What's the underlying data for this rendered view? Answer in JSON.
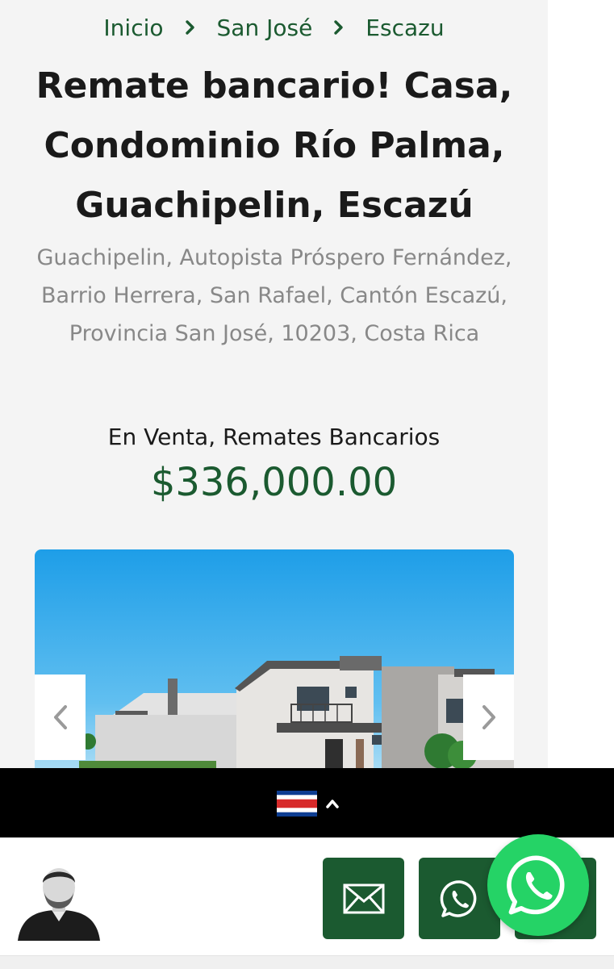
{
  "breadcrumb": {
    "items": [
      "Inicio",
      "San José",
      "Escazu"
    ],
    "separator_icon": "chevron-right-icon"
  },
  "listing": {
    "title": "Remate bancario! Casa, Condominio Río Palma, Guachipelin, Escazú",
    "address": "Guachipelin, Autopista Próspero Fernández, Barrio Herrera, San Rafael, Cantón Escazú, Provincia San José, 10203, Costa Rica",
    "status": "En Venta, Remates Bancarios",
    "price": "$336,000.00"
  },
  "gallery": {
    "prev_icon": "chevron-left-icon",
    "next_icon": "chevron-right-icon",
    "image": "house-photo"
  },
  "language_switcher": {
    "flag_icon": "costa-rica-flag-icon",
    "toggle_icon": "chevron-up-icon"
  },
  "contact_bar": {
    "avatar": "agent-avatar",
    "buttons": [
      {
        "name": "email",
        "icon": "envelope-icon"
      },
      {
        "name": "whatsapp",
        "icon": "whatsapp-icon"
      },
      {
        "name": "phone",
        "icon": "phone-icon"
      }
    ],
    "floating_button_icon": "whatsapp-icon"
  },
  "colors": {
    "brand_green": "#1b5a30",
    "whatsapp_green": "#25d366",
    "panel_background": "#f4f4f4",
    "address_gray": "#888888",
    "sky_blue": "#1e9ee8"
  }
}
